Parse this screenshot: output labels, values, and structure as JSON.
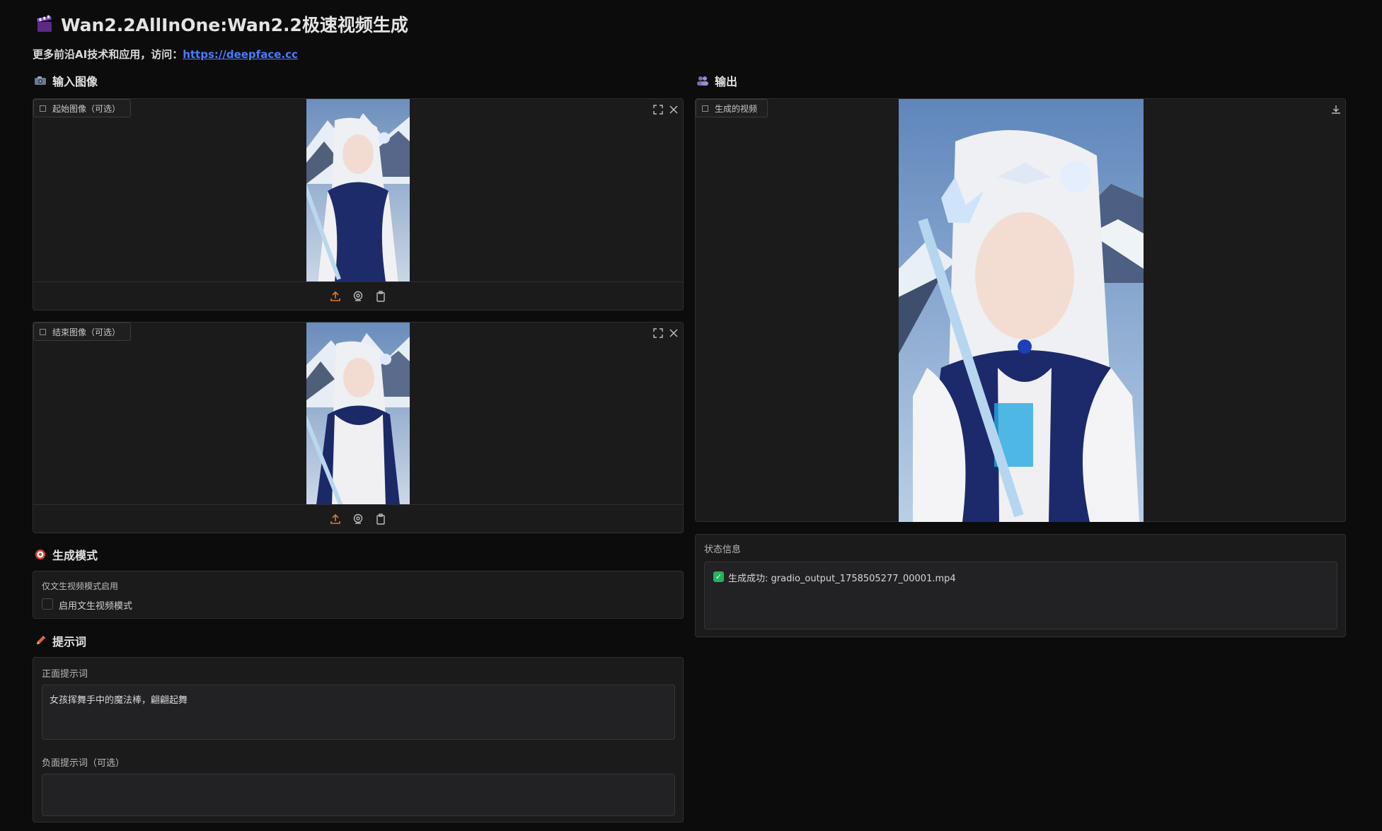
{
  "header": {
    "title": "Wan2.2AllInOne:Wan2.2极速视频生成",
    "subtitle_prefix": "更多前沿AI技术和应用，访问：",
    "link_text": "https://deepface.cc",
    "title_icon": "clapperboard-icon"
  },
  "input_section": {
    "title": "输入图像",
    "icon": "camera-icon",
    "start_image": {
      "label": "起始图像（可选）"
    },
    "end_image": {
      "label": "结束图像（可选）"
    }
  },
  "output_section": {
    "title": "输出",
    "icon": "people-icon",
    "video": {
      "label": "生成的视频"
    }
  },
  "mode_section": {
    "title": "生成模式",
    "icon": "target-icon",
    "group_label": "仅文生视频模式启用",
    "checkbox_label": "启用文生视频模式",
    "checked": false
  },
  "prompt_section": {
    "title": "提示词",
    "icon": "pencil-icon",
    "positive_label": "正面提示词",
    "positive_value": "女孩挥舞手中的魔法棒，翩翩起舞",
    "negative_label": "负面提示词（可选）",
    "negative_value": ""
  },
  "status_section": {
    "label": "状态信息",
    "message": "生成成功: gradio_output_1758505277_00001.mp4"
  },
  "colors": {
    "background": "#0c0c0d",
    "panel": "#1b1b1c",
    "accent_upload": "#e8762b",
    "link": "#4a7cff",
    "success": "#22b35e"
  }
}
